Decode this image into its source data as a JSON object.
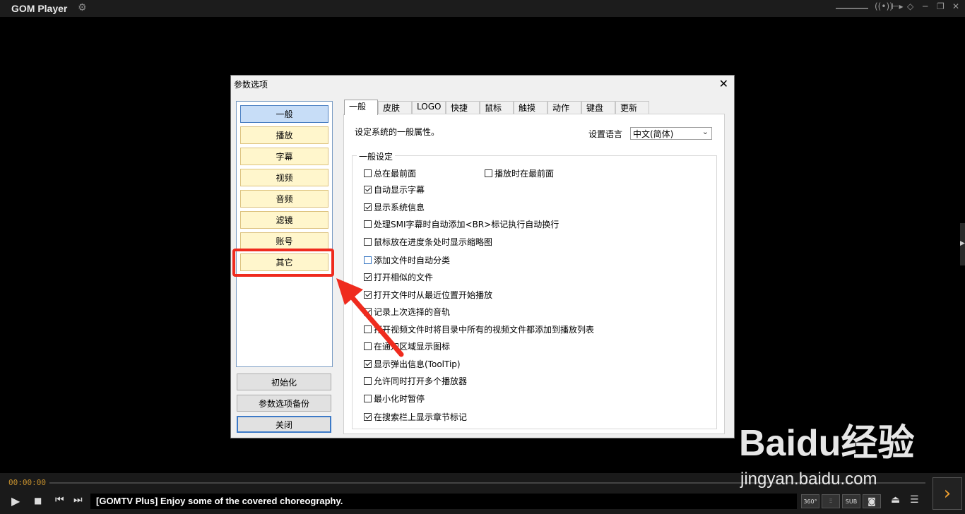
{
  "app": {
    "title": "GOM Player"
  },
  "dialog": {
    "title": "参数选项",
    "categories": [
      {
        "label": "一般",
        "selected": true
      },
      {
        "label": "播放"
      },
      {
        "label": "字幕"
      },
      {
        "label": "视频"
      },
      {
        "label": "音频"
      },
      {
        "label": "滤镜"
      },
      {
        "label": "账号"
      },
      {
        "label": "其它",
        "highlighted": true
      }
    ],
    "buttons": {
      "reset": "初始化",
      "backup": "参数选项备份",
      "close": "关闭"
    },
    "tabs": [
      "一般",
      "皮肤",
      "LOGO",
      "快捷",
      "鼠标",
      "触摸",
      "动作",
      "键盘",
      "更新"
    ],
    "description": "设定系统的一般属性。",
    "language": {
      "label": "设置语言",
      "value": "中文(简体)"
    },
    "group_title": "一般设定",
    "options": [
      {
        "label": "总在最前面",
        "checked": false
      },
      {
        "label": "播放时在最前面",
        "checked": false
      },
      {
        "label": "自动显示字幕",
        "checked": true
      },
      {
        "label": "显示系统信息",
        "checked": true
      },
      {
        "label": "处理SMI字幕时自动添加<BR>标记执行自动换行",
        "checked": false
      },
      {
        "label": "鼠标放在进度条处时显示缩略图",
        "checked": false
      },
      {
        "label": "添加文件时自动分类",
        "checked": false
      },
      {
        "label": "打开相似的文件",
        "checked": true
      },
      {
        "label": "打开文件时从最近位置开始播放",
        "checked": true
      },
      {
        "label": "记录上次选择的音轨",
        "checked": true
      },
      {
        "label": "打开视频文件时将目录中所有的视频文件都添加到播放列表",
        "checked": false
      },
      {
        "label": "在通知区域显示图标",
        "checked": false
      },
      {
        "label": "显示弹出信息(ToolTip)",
        "checked": true
      },
      {
        "label": "允许同时打开多个播放器",
        "checked": false
      },
      {
        "label": "最小化时暂停",
        "checked": false
      },
      {
        "label": "在搜索栏上显示章节标记",
        "checked": true
      }
    ]
  },
  "player": {
    "time": "00:00:00",
    "ticker": "[GOMTV Plus] Enjoy some of the covered choreography.",
    "right_buttons": [
      "360°",
      "SUB"
    ]
  },
  "watermark": {
    "logo": "Baidu经验",
    "url": "jingyan.baidu.com"
  },
  "colors": {
    "highlight_red": "#ef2b1e",
    "time_orange": "#c8922e"
  }
}
